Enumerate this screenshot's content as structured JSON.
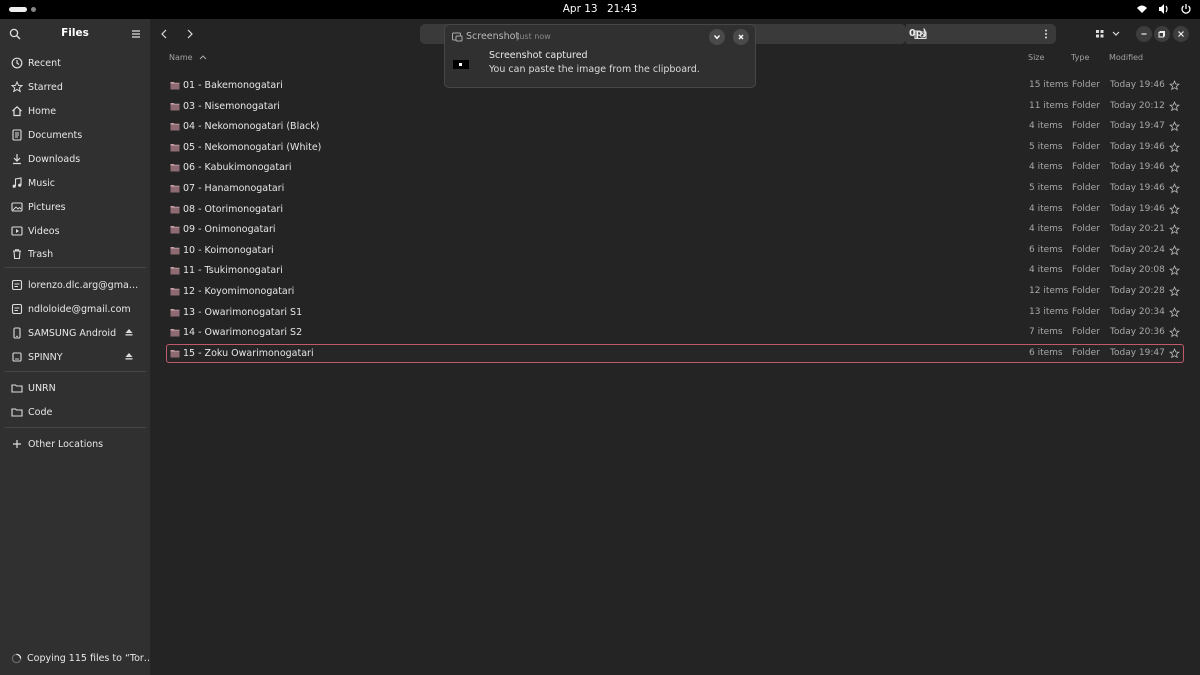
{
  "topbar": {
    "date": "Apr 13",
    "time": "21:43"
  },
  "sidebar": {
    "title": "Files",
    "places": [
      {
        "label": "Recent",
        "icon": "clock-icon"
      },
      {
        "label": "Starred",
        "icon": "star-icon"
      },
      {
        "label": "Home",
        "icon": "home-icon"
      },
      {
        "label": "Documents",
        "icon": "document-icon"
      },
      {
        "label": "Downloads",
        "icon": "download-icon"
      },
      {
        "label": "Music",
        "icon": "music-icon"
      },
      {
        "label": "Pictures",
        "icon": "picture-icon"
      },
      {
        "label": "Videos",
        "icon": "video-icon"
      },
      {
        "label": "Trash",
        "icon": "trash-icon"
      }
    ],
    "accounts": [
      {
        "label": "lorenzo.dlc.arg@gmail.com",
        "icon": "account-icon"
      },
      {
        "label": "ndloloide@gmail.com",
        "icon": "account-icon"
      }
    ],
    "devices": [
      {
        "label": "SAMSUNG Android",
        "icon": "phone-icon"
      },
      {
        "label": "SPINNY",
        "icon": "drive-icon"
      }
    ],
    "bookmarks": [
      {
        "label": "UNRN",
        "icon": "folder-icon"
      },
      {
        "label": "Code",
        "icon": "folder-icon"
      }
    ],
    "other_locations": "Other Locations",
    "status": "Copying 115 files to “Tor…"
  },
  "header": {
    "path_tail": "0p)"
  },
  "columns": {
    "name": "Name",
    "size": "Size",
    "type": "Type",
    "modified": "Modified"
  },
  "files": [
    {
      "name": "01 - Bakemonogatari",
      "size": "15 items",
      "type": "Folder",
      "modified": "Today 19:46"
    },
    {
      "name": "03 - Nisemonogatari",
      "size": "11 items",
      "type": "Folder",
      "modified": "Today 20:12"
    },
    {
      "name": "04 - Nekomonogatari (Black)",
      "size": "4 items",
      "type": "Folder",
      "modified": "Today 19:47"
    },
    {
      "name": "05 - Nekomonogatari (White)",
      "size": "5 items",
      "type": "Folder",
      "modified": "Today 19:46"
    },
    {
      "name": "06 - Kabukimonogatari",
      "size": "4 items",
      "type": "Folder",
      "modified": "Today 19:46"
    },
    {
      "name": "07 - Hanamonogatari",
      "size": "5 items",
      "type": "Folder",
      "modified": "Today 19:46"
    },
    {
      "name": "08 - Otorimonogatari",
      "size": "4 items",
      "type": "Folder",
      "modified": "Today 19:46"
    },
    {
      "name": "09 - Onimonogatari",
      "size": "4 items",
      "type": "Folder",
      "modified": "Today 20:21"
    },
    {
      "name": "10 - Koimonogatari",
      "size": "6 items",
      "type": "Folder",
      "modified": "Today 20:24"
    },
    {
      "name": "11 - Tsukimonogatari",
      "size": "4 items",
      "type": "Folder",
      "modified": "Today 20:08"
    },
    {
      "name": "12 - Koyomimonogatari",
      "size": "12 items",
      "type": "Folder",
      "modified": "Today 20:28"
    },
    {
      "name": "13 - Owarimonogatari S1",
      "size": "13 items",
      "type": "Folder",
      "modified": "Today 20:34"
    },
    {
      "name": "14 - Owarimonogatari S2",
      "size": "7 items",
      "type": "Folder",
      "modified": "Today 20:36"
    },
    {
      "name": "15 - Zoku Owarimonogatari",
      "size": "6 items",
      "type": "Folder",
      "modified": "Today 19:47"
    }
  ],
  "selected_index": 13,
  "notification": {
    "app": "Screenshot",
    "time": "Just now",
    "title": "Screenshot captured",
    "body": "You can paste the image from the clipboard."
  },
  "colors": {
    "accent": "#c05a6a",
    "folder": "#c9a0a8",
    "sidebar": "#303030",
    "content": "#242424"
  }
}
